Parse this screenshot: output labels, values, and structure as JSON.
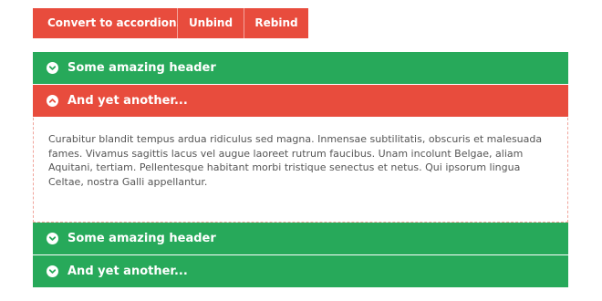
{
  "toolbar": {
    "convert_label": "Convert to accordion...",
    "unbind_label": "Unbind",
    "rebind_label": "Rebind"
  },
  "accordion": {
    "items": [
      {
        "title": "Some amazing header",
        "state": "collapsed",
        "color": "#27a95a"
      },
      {
        "title": "And yet another...",
        "state": "expanded",
        "color": "#e84c3d",
        "content": "Curabitur blandit tempus ardua ridiculus sed magna. Inmensae subtilitatis, obscuris et malesuada fames. Vivamus sagittis lacus vel augue laoreet rutrum faucibus. Unam incolunt Belgae, aliam Aquitani, tertiam. Pellentesque habitant morbi tristique senectus et netus. Qui ipsorum lingua Celtae, nostra Galli appellantur."
      },
      {
        "title": "Some amazing header",
        "state": "collapsed",
        "color": "#27a95a"
      },
      {
        "title": "And yet another...",
        "state": "collapsed",
        "color": "#27a95a"
      }
    ]
  },
  "colors": {
    "accent_red": "#e84c3d",
    "accent_green": "#27a95a"
  }
}
